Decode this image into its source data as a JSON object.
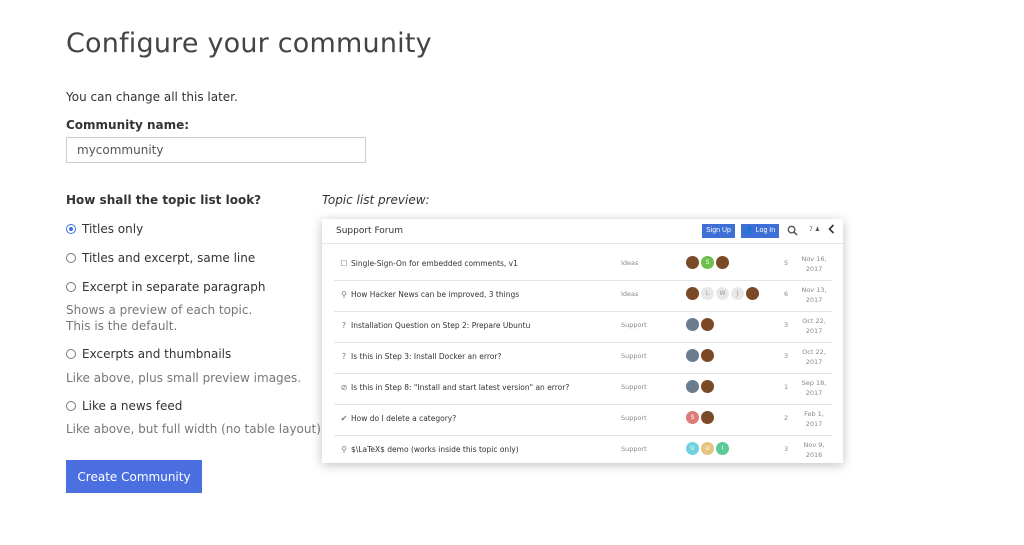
{
  "page": {
    "title": "Configure your community",
    "subtitle": "You can change all this later.",
    "community_name_label": "Community name:",
    "community_name_value": "mycommunity",
    "topic_look_label": "How shall the topic list look?",
    "options": [
      {
        "label": "Titles only",
        "checked": true
      },
      {
        "label": "Titles and excerpt, same line",
        "checked": false
      },
      {
        "label": "Excerpt in separate paragraph",
        "checked": false,
        "hint": [
          "Shows a preview of each topic.",
          "This is the default."
        ]
      },
      {
        "label": "Excerpts and thumbnails",
        "checked": false,
        "hint": [
          "Like above, plus small preview images."
        ]
      },
      {
        "label": "Like a news feed",
        "checked": false,
        "hint": [
          "Like above, but full width (no table layout)."
        ]
      }
    ],
    "create_button": "Create Community",
    "preview_label": "Topic list preview:"
  },
  "preview": {
    "forum_title": "Support Forum",
    "signup": "Sign Up",
    "login": "👤 Log In",
    "unread": "7 ♟",
    "icons": {
      "search": "search-icon",
      "back": "chevron-left-icon"
    },
    "topics": [
      {
        "icon": "☐",
        "icon_name": "checkbox-icon",
        "title": "Single-Sign-On for embedded comments, v1",
        "category": "Ideas",
        "avatars": [
          {
            "c": "brown",
            "t": ""
          },
          {
            "c": "green",
            "t": "S"
          },
          {
            "c": "brown",
            "t": ""
          }
        ],
        "replies": "5",
        "date": [
          "Nov 16,",
          "2017"
        ]
      },
      {
        "icon": "⚲",
        "icon_name": "idea-icon",
        "title": "How Hacker News can be improved, 3 things",
        "category": "Ideas",
        "avatars": [
          {
            "c": "brown",
            "t": ""
          },
          {
            "c": "gray",
            "t": "L"
          },
          {
            "c": "gray",
            "t": "W"
          },
          {
            "c": "gray",
            "t": "J"
          },
          {
            "c": "brown",
            "t": ""
          }
        ],
        "replies": "6",
        "date": [
          "Nov 13,",
          "2017"
        ]
      },
      {
        "icon": "?",
        "icon_name": "question-icon",
        "title": "Installation Question on Step 2: Prepare Ubuntu",
        "category": "Support",
        "avatars": [
          {
            "c": "photo",
            "t": ""
          },
          {
            "c": "brown",
            "t": ""
          }
        ],
        "replies": "3",
        "date": [
          "Oct 22,",
          "2017"
        ]
      },
      {
        "icon": "?",
        "icon_name": "question-icon",
        "title": "Is this in Step 3: Install Docker an error?",
        "category": "Support",
        "avatars": [
          {
            "c": "photo",
            "t": ""
          },
          {
            "c": "brown",
            "t": ""
          }
        ],
        "replies": "3",
        "date": [
          "Oct 22,",
          "2017"
        ]
      },
      {
        "icon": "⊘",
        "icon_name": "problem-icon",
        "title": "Is this in Step 8: \"Install and start latest version\" an error?",
        "category": "Support",
        "avatars": [
          {
            "c": "photo",
            "t": ""
          },
          {
            "c": "brown",
            "t": ""
          }
        ],
        "replies": "1",
        "date": [
          "Sep 18,",
          "2017"
        ]
      },
      {
        "icon": "✔",
        "icon_name": "check-icon",
        "title": "How do I delete a category?",
        "category": "Support",
        "avatars": [
          {
            "c": "pink",
            "t": "S"
          },
          {
            "c": "brown",
            "t": ""
          }
        ],
        "replies": "2",
        "date": [
          "Feb 1,",
          "2017"
        ]
      },
      {
        "icon": "⚲",
        "icon_name": "idea-icon",
        "title": "$\\LaTeX$ demo (works inside this topic only)",
        "category": "Support",
        "avatars": [
          {
            "c": "cyan",
            "t": "U"
          },
          {
            "c": "gold",
            "t": "U"
          },
          {
            "c": "teal",
            "t": "I"
          }
        ],
        "replies": "3",
        "date": [
          "Nov 9,",
          "2016"
        ]
      }
    ]
  }
}
